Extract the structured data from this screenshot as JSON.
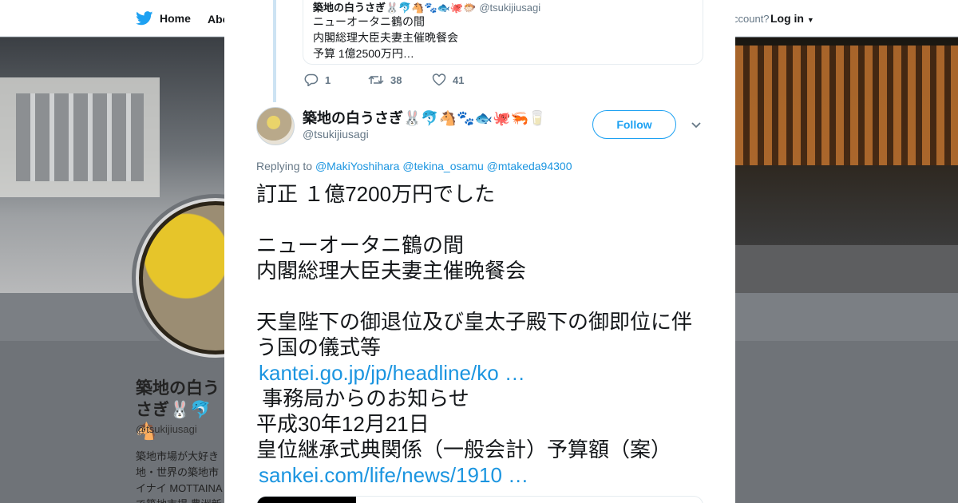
{
  "background": {
    "nav": {
      "home_label": "Home",
      "about_label": "Abo",
      "account_prompt": "ccount?",
      "login_label": "Log in"
    },
    "profile": {
      "name": "築地の白うさぎ🐰🐬🐴",
      "handle": "@tsukijiusagi",
      "bio": "築地市場が大好き地・世界の築地市イナイ MOTTAINAで築地市場 豊洲新"
    }
  },
  "modal": {
    "quoted_tweet": {
      "header_name": "築地の白うさぎ🐰🐬🐴🐾🐟🐙🐡",
      "header_handle": "@tsukijiusagi",
      "lines": [
        "ニューオータニ鶴の間",
        "内閣総理大臣夫妻主催晩餐会",
        "予算 1億2500万円…"
      ]
    },
    "actions": {
      "reply_count": "1",
      "retweet_count": "38",
      "like_count": "41"
    },
    "tweet": {
      "author_name": "築地の白うさぎ🐰🐬🐴🐾🐟🐙🦐🥛",
      "author_handle": "@tsukijiusagi",
      "follow_label": "Follow",
      "replying_prefix": "Replying to",
      "mentions": [
        "@MakiYoshihara",
        "@tekina_osamu",
        "@mtakeda94300"
      ],
      "text": {
        "line1": "訂正 １億7200万円でした",
        "line2": "ニューオータニ鶴の間",
        "line3": "内閣総理大臣夫妻主催晩餐会",
        "line4": "天皇陛下の御退位及び皇太子殿下の御即位に伴う国の儀式等",
        "link1": "kantei.go.jp/jp/headline/ko …",
        "line5": " 事務局からのお知らせ",
        "line6": "平成30年12月21日",
        "line7": "皇位継承式典関係（一般会計）予算額（案）",
        "link2": "sankei.com/life/news/1910 …"
      }
    }
  },
  "colors": {
    "accent": "#1da1f2",
    "link": "#1b95e0",
    "text": "#14171a",
    "muted": "#657786"
  },
  "icons": [
    "twitter-bird-icon",
    "close-icon",
    "reply-icon",
    "retweet-icon",
    "heart-icon",
    "chevron-down-icon"
  ]
}
